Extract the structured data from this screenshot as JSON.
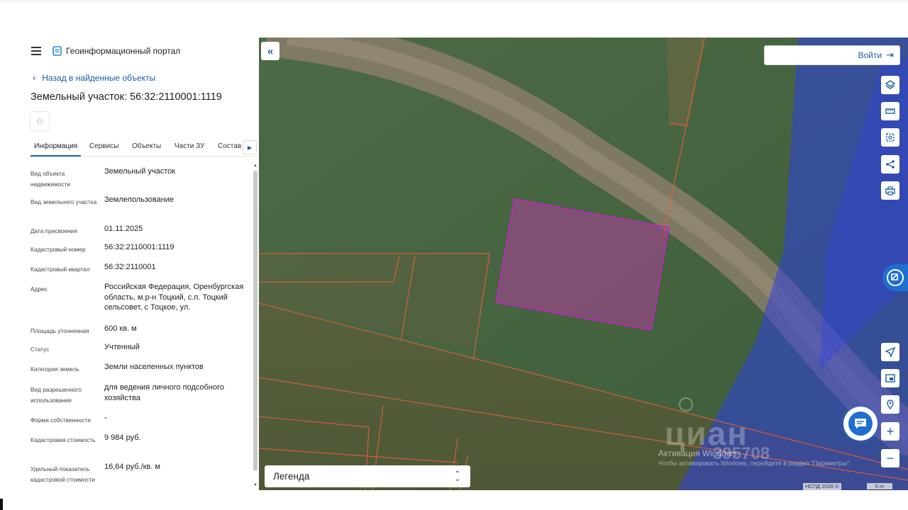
{
  "header": {
    "portal_title": "Геоинформационный портал"
  },
  "panel": {
    "back_link": "Назад в найденные объекты",
    "parcel_title": "Земельный участок: 56:32:2110001:1119",
    "tabs": [
      {
        "label": "Информация",
        "active": true
      },
      {
        "label": "Сервисы",
        "active": false
      },
      {
        "label": "Объекты",
        "active": false
      },
      {
        "label": "Части ЗУ",
        "active": false
      },
      {
        "label": "Состав",
        "active": false
      }
    ],
    "rows": [
      {
        "label": "Вид объекта недвижимости",
        "value": "Земельный участок"
      },
      {
        "label": "Вид земельного участка",
        "value": "Землепользование"
      },
      {
        "label": "Дата присвоения",
        "value": "01.11.2025"
      },
      {
        "label": "Кадастровый номер",
        "value": "56:32:2110001:1119"
      },
      {
        "label": "Кадастровый квартал",
        "value": "56:32:2110001"
      },
      {
        "label": "Адрес",
        "value": "Российская Федерация, Оренбургская область, м.р-н Тоцкий, с.п. Тоцкий сельсовет, с Тоцкое, ул."
      },
      {
        "label": "Площадь уточненная",
        "value": "600 кв. м"
      },
      {
        "label": "Статус",
        "value": "Учтенный"
      },
      {
        "label": "Категория земель",
        "value": "Земли населенных пунктов"
      },
      {
        "label": "Вид разрешенного использования",
        "value": "для ведения личного подсобного хозяйства"
      },
      {
        "label": "Форма собственности",
        "value": "-"
      },
      {
        "label": "Кадастровая стоимость",
        "value": "9 984 руб."
      },
      {
        "label": "Удельный показатель кадастровой стоимости",
        "value": "16,64 руб./кв. м"
      }
    ]
  },
  "map": {
    "login_label": "Войти",
    "legend_label": "Легенда",
    "watermark_brand": "циан",
    "watermark_number": "395708",
    "windows_activation_title": "Активация Windows",
    "windows_activation_text": "Чтобы активировать Windows, перейдите в раздел \"Параметры\".",
    "copyright": "НСПД 2026 ©",
    "scale_label": "5 m",
    "colors": {
      "parcel_fill": "#b0409a",
      "parcel_stroke": "#c026c6",
      "boundary": "#e0603a",
      "zone_overlay": "#2d3fe0",
      "accent": "#1a5da8"
    }
  }
}
